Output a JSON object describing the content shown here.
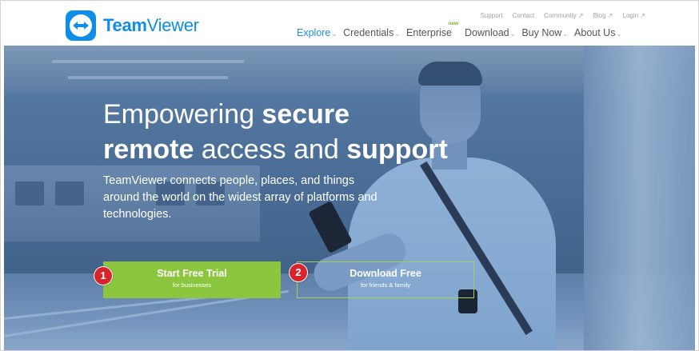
{
  "brand": {
    "name_bold": "Team",
    "name_rest": "Viewer"
  },
  "top_links": [
    {
      "label": "Support"
    },
    {
      "label": "Contact"
    },
    {
      "label": "Community ↗"
    },
    {
      "label": "Blog ↗"
    },
    {
      "label": "Login ↗"
    }
  ],
  "main_nav": [
    {
      "label": "Explore",
      "caret": "⌄",
      "active": true
    },
    {
      "label": "Credentials",
      "caret": "⌄"
    },
    {
      "label": "Enterprise",
      "caret": "",
      "badge": "new"
    },
    {
      "label": "Download",
      "caret": "⌄"
    },
    {
      "label": "Buy Now",
      "caret": "⌄"
    },
    {
      "label": "About Us",
      "caret": "⌄"
    }
  ],
  "hero": {
    "line1_light": "Empowering ",
    "line1_bold": "secure",
    "line2_bold1": "remote",
    "line2_light": " access and ",
    "line2_bold2": "support",
    "subtext": "TeamViewer connects people, places, and things around the world on the widest array of platforms and technologies."
  },
  "buttons": {
    "trial": {
      "label": "Start Free Trial",
      "sub": "for businesses"
    },
    "download": {
      "label": "Download Free",
      "sub": "for friends & family"
    }
  },
  "annotations": {
    "one": "1",
    "two": "2"
  },
  "colors": {
    "brand_blue": "#0e8ee9",
    "accent_green": "#8cc63f",
    "badge_red": "#d8252c"
  }
}
